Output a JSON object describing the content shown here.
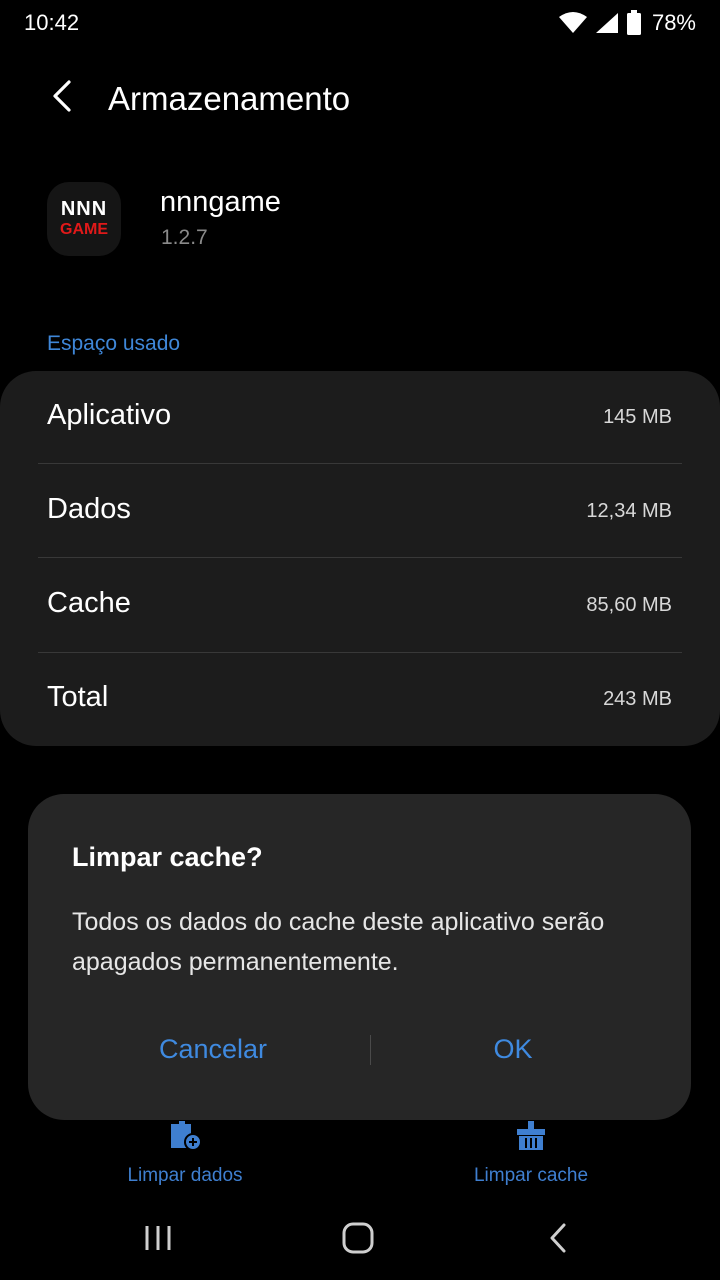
{
  "status_bar": {
    "time": "10:42",
    "battery": "78%",
    "icons": [
      "wifi-icon",
      "cell-signal-icon",
      "battery-icon"
    ]
  },
  "header": {
    "back_icon": "chevron-left-icon",
    "title": "Armazenamento"
  },
  "app": {
    "icon_line1": "NNN",
    "icon_line2": "GAME",
    "name": "nnngame",
    "version": "1.2.7"
  },
  "storage": {
    "section_label": "Espaço usado",
    "rows": [
      {
        "label": "Aplicativo",
        "value": "145 MB"
      },
      {
        "label": "Dados",
        "value": "12,34 MB"
      },
      {
        "label": "Cache",
        "value": "85,60 MB"
      },
      {
        "label": "Total",
        "value": "243 MB"
      }
    ]
  },
  "actions": {
    "clear_data": {
      "label": "Limpar dados",
      "icon": "clear-data-icon"
    },
    "clear_cache": {
      "label": "Limpar cache",
      "icon": "clear-cache-icon"
    }
  },
  "dialog": {
    "title": "Limpar cache?",
    "message": "Todos os dados do cache deste aplicativo serão apagados permanentemente.",
    "cancel_label": "Cancelar",
    "ok_label": "OK"
  },
  "nav_bar": {
    "icons": [
      "recents-icon",
      "home-icon",
      "back-icon"
    ]
  },
  "colors": {
    "accent": "#3f87d8",
    "background": "#000000",
    "card": "#1c1c1c",
    "dialog": "#262626",
    "app_icon_red": "#e01919"
  }
}
